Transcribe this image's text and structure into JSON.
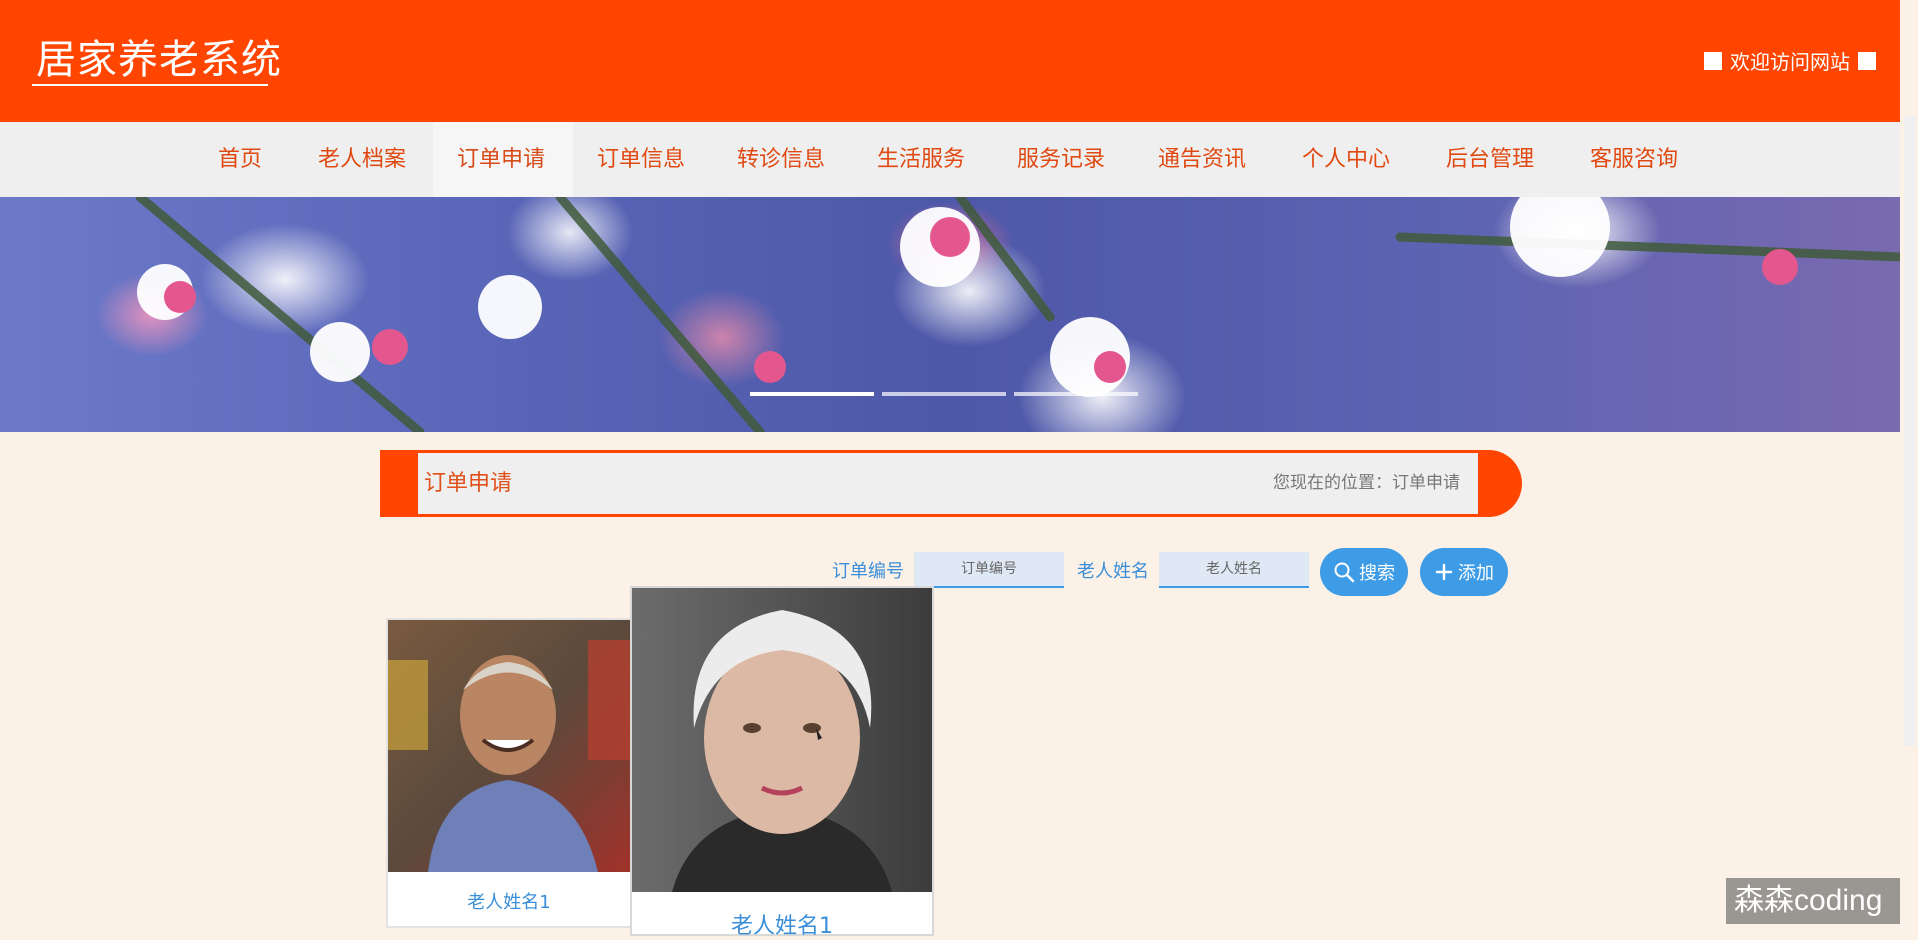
{
  "header": {
    "site_title": "居家养老系统",
    "welcome_text": "欢迎访问网站"
  },
  "nav": {
    "items": [
      {
        "label": "首页"
      },
      {
        "label": "老人档案"
      },
      {
        "label": "订单申请"
      },
      {
        "label": "订单信息"
      },
      {
        "label": "转诊信息"
      },
      {
        "label": "生活服务"
      },
      {
        "label": "服务记录"
      },
      {
        "label": "通告资讯"
      },
      {
        "label": "个人中心"
      },
      {
        "label": "后台管理"
      },
      {
        "label": "客服咨询"
      }
    ],
    "active": "订单申请"
  },
  "page": {
    "title": "订单申请",
    "location": "您现在的位置：订单申请"
  },
  "search": {
    "order_no_label": "订单编号",
    "order_no_placeholder": "订单编号",
    "elder_name_label": "老人姓名",
    "elder_name_placeholder": "老人姓名",
    "search_button": "搜索",
    "add_button": "添加"
  },
  "cards": [
    {
      "name": "老人姓名1"
    },
    {
      "name": "老人姓名1"
    }
  ],
  "watermark": "森森coding",
  "colors": {
    "brand": "#ff4500",
    "accent": "#3e9be6",
    "page_bg": "#fbf1e7"
  }
}
